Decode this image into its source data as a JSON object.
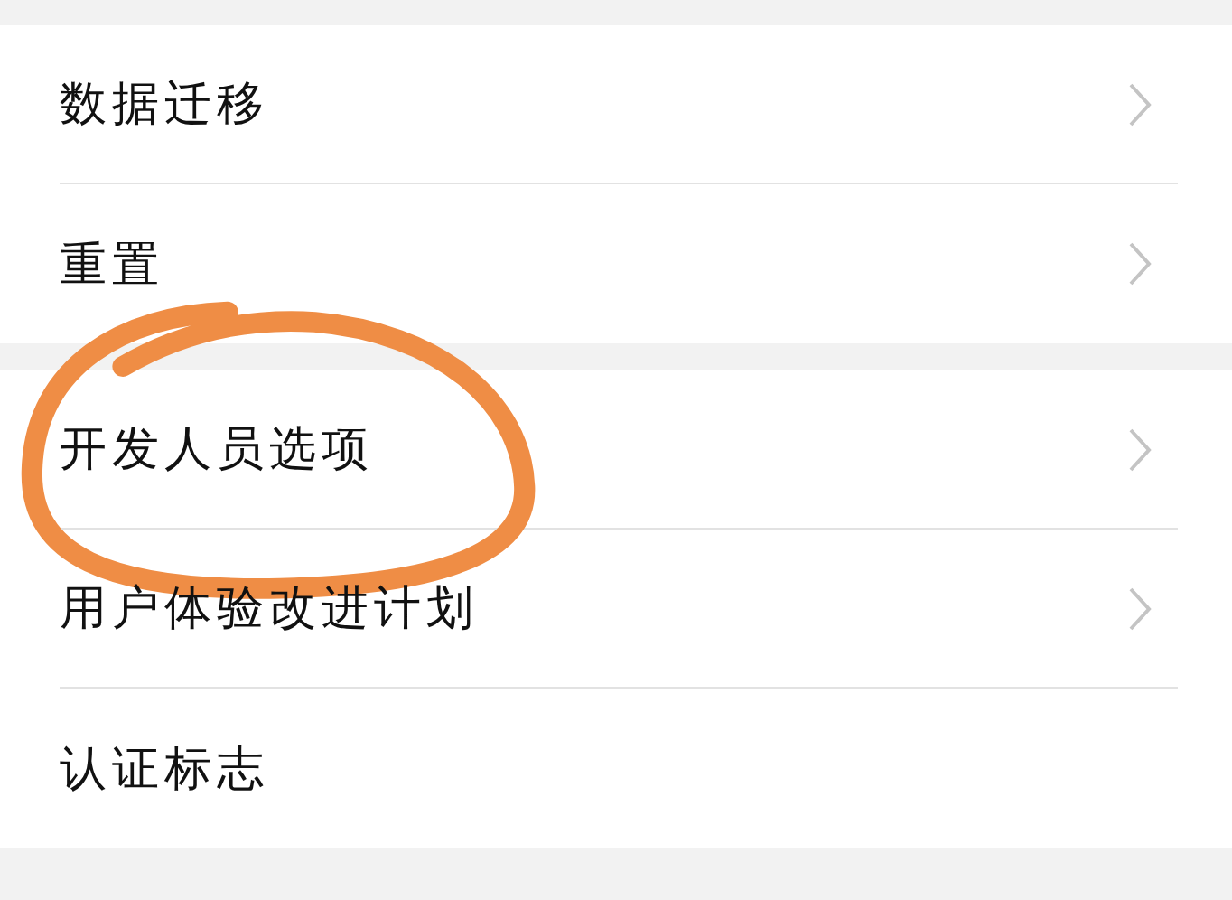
{
  "groups": [
    {
      "rows": [
        {
          "label": "数据迁移",
          "chevron": true,
          "highlighted": false
        },
        {
          "label": "重置",
          "chevron": true,
          "highlighted": false
        }
      ]
    },
    {
      "rows": [
        {
          "label": "开发人员选项",
          "chevron": true,
          "highlighted": true
        },
        {
          "label": "用户体验改进计划",
          "chevron": true,
          "highlighted": false
        },
        {
          "label": "认证标志",
          "chevron": false,
          "highlighted": false
        }
      ]
    }
  ]
}
